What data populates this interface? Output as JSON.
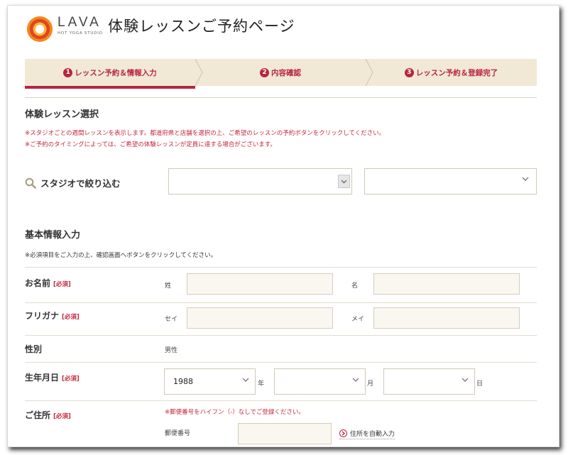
{
  "header": {
    "brand_name": "LAVA",
    "brand_sub": "HOT YOGA STUDIO",
    "page_title": "体験レッスンご予約ページ"
  },
  "steps": [
    {
      "num": "1",
      "label": "レッスン予約＆情報入力",
      "active": true
    },
    {
      "num": "2",
      "label": "内容確認",
      "active": false
    },
    {
      "num": "3",
      "label": "レッスン予約＆登録完了",
      "active": false
    }
  ],
  "lesson_section": {
    "title": "体験レッスン選択",
    "notes": [
      "※スタジオごとの週間レッスンを表示します。都道府県と店舗を選択の上、ご希望のレッスンの予約ボタンをクリックしてください。",
      "※ご予約のタイミングによっては、ご希望の体験レッスンが定員に達する場合がございます。"
    ],
    "filter_label": "スタジオで絞り込む",
    "prefecture_value": "",
    "store_value": ""
  },
  "basic_section": {
    "title": "基本情報入力",
    "note": "※必須項目をご入力の上、確認画面へボタンをクリックしてください。",
    "required_tag": "[必須]",
    "name": {
      "label": "お名前",
      "last_label": "姓",
      "first_label": "名",
      "last_value": "",
      "first_value": ""
    },
    "furigana": {
      "label": "フリガナ",
      "last_label": "セイ",
      "first_label": "メイ",
      "last_value": "",
      "first_value": ""
    },
    "gender": {
      "label": "性別",
      "value": "男性"
    },
    "birthdate": {
      "label": "生年月日",
      "year": "1988",
      "month": "",
      "day": "",
      "year_unit": "年",
      "month_unit": "月",
      "day_unit": "日"
    },
    "address": {
      "label": "ご住所",
      "note": "※郵便番号をハイフン（-）なしでご登録ください。",
      "zip_label": "郵便番号",
      "zip_value": "",
      "auto_fill": "住所を自動入力"
    }
  },
  "colors": {
    "accent": "#b8253d",
    "step_bg": "#f1e9d5",
    "input_bg": "#faf7f1",
    "border": "#d2c9b5"
  },
  "icons": [
    "lava-logo",
    "search-icon",
    "chevron-down-icon",
    "circle-arrow-icon"
  ]
}
